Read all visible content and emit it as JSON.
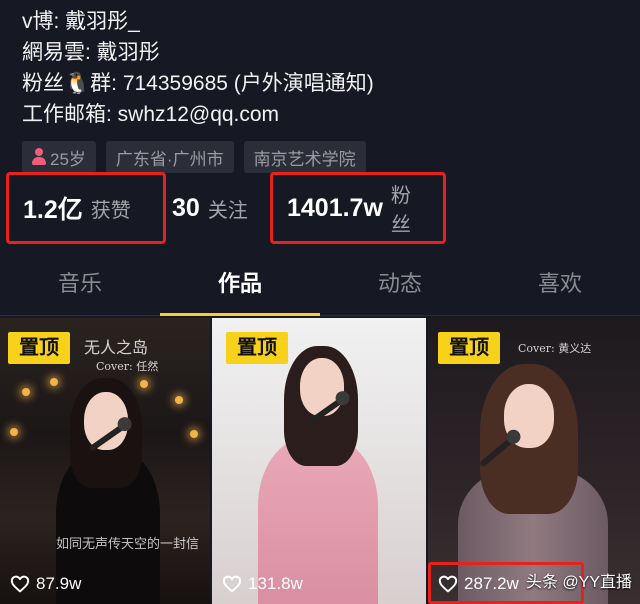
{
  "bio": {
    "line1": "v博: 戴羽彤_",
    "line2": "網易雲: 戴羽彤",
    "line3": "粉丝🐧群: 714359685 (户外演唱通知)",
    "line4": "工作邮箱: swhz12@qq.com"
  },
  "tags": {
    "age": "25岁",
    "location": "广东省·广州市",
    "school": "南京艺术学院"
  },
  "stats": {
    "likes_num": "1.2亿",
    "likes_label": "获赞",
    "following_num": "30",
    "following_label": "关注",
    "fans_num": "1401.7w",
    "fans_label": "粉丝"
  },
  "tabs": [
    {
      "label": "音乐"
    },
    {
      "label": "作品"
    },
    {
      "label": "动态"
    },
    {
      "label": "喜欢"
    }
  ],
  "videos": [
    {
      "pinned": "置顶",
      "title": "无人之岛",
      "credit": "Cover: 任然",
      "subtitle": "如同无声传天空的一封信",
      "likes": "87.9w"
    },
    {
      "pinned": "置顶",
      "likes": "131.8w"
    },
    {
      "pinned": "置顶",
      "credit": "Cover: 黄义达",
      "likes": "287.2w"
    }
  ],
  "watermark": "头条 @YY直播",
  "colors": {
    "background": "#161823",
    "accent_yellow": "#f8d11b",
    "highlight_red": "#e8221b",
    "tab_underline": "#facc2e"
  }
}
